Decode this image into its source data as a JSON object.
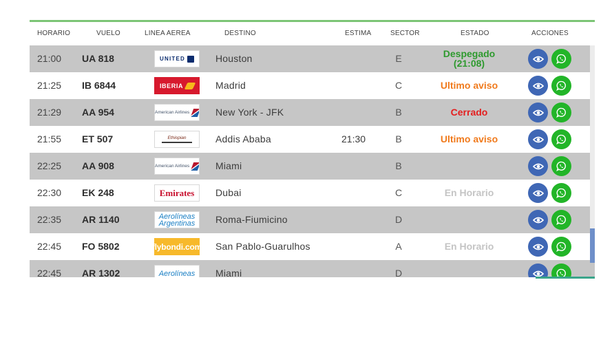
{
  "columns": {
    "time": "HORARIO",
    "flight": "VUELO",
    "airline": "LINEA AEREA",
    "destination": "DESTINO",
    "estimate": "ESTIMA",
    "sector": "SECTOR",
    "status": "ESTADO",
    "actions": "ACCIONES"
  },
  "colors": {
    "accent_line": "#7cc576",
    "status_departed": "#2e9a2e",
    "status_last_call": "#f07a1c",
    "status_closed": "#e41e1e",
    "status_on_time": "#c4c4c4",
    "view_button": "#3f67b5",
    "whatsapp_button": "#22b528"
  },
  "flights": [
    {
      "time": "21:00",
      "flight": "UA 818",
      "airline_logo_text": "UNITED",
      "destination": "Houston",
      "estimate": "",
      "sector": "E",
      "status": "Despegado",
      "status_detail": "(21:08)"
    },
    {
      "time": "21:25",
      "flight": "IB 6844",
      "airline_logo_text": "IBERIA",
      "destination": "Madrid",
      "estimate": "",
      "sector": "C",
      "status": "Ultimo aviso"
    },
    {
      "time": "21:29",
      "flight": "AA 954",
      "airline_logo_text": "American Airlines",
      "destination": "New York - JFK",
      "estimate": "",
      "sector": "B",
      "status": "Cerrado"
    },
    {
      "time": "21:55",
      "flight": "ET 507",
      "airline_logo_text": "Ethiopian",
      "destination": "Addis Ababa",
      "estimate": "21:30",
      "sector": "B",
      "status": "Ultimo aviso"
    },
    {
      "time": "22:25",
      "flight": "AA 908",
      "airline_logo_text": "American Airlines",
      "destination": "Miami",
      "estimate": "",
      "sector": "B",
      "status": ""
    },
    {
      "time": "22:30",
      "flight": "EK 248",
      "airline_logo_text": "Emirates",
      "destination": "Dubai",
      "estimate": "",
      "sector": "C",
      "status": "En Horario"
    },
    {
      "time": "22:35",
      "flight": "AR 1140",
      "airline_logo_text": "Aerolíneas Argentinas",
      "destination": "Roma-Fiumicino",
      "estimate": "",
      "sector": "D",
      "status": ""
    },
    {
      "time": "22:45",
      "flight": "FO 5802",
      "airline_logo_text": "flybondi.com",
      "destination": "San Pablo-Guarulhos",
      "estimate": "",
      "sector": "A",
      "status": "En Horario"
    },
    {
      "time": "22:45",
      "flight": "AR 1302",
      "airline_logo_text": "Aerolíneas",
      "destination": "Miami",
      "estimate": "",
      "sector": "D",
      "status": ""
    }
  ],
  "icons": {
    "view": "eye-icon",
    "share": "whatsapp-icon"
  }
}
